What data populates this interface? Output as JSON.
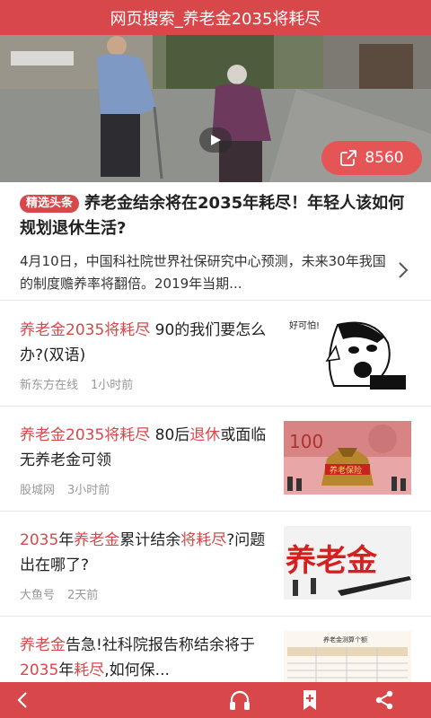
{
  "header": {
    "title": "网页搜索_养老金2035将耗尽"
  },
  "hero": {
    "share_count": "8560"
  },
  "headline": {
    "tag": "精选头条",
    "title": "养老金结余将在2035年耗尽！年轻人该如何规划退休生活?",
    "summary": "4月10日，中国科社院世界社保研究中心预测，未来30年我国的制度赡养率将翻倍。2019年当期..."
  },
  "news": [
    {
      "title_parts": [
        {
          "text": "养老金2035将耗尽",
          "highlight": true
        },
        {
          "text": " 90的我们要怎么办?(双语)",
          "highlight": false
        }
      ],
      "source": "新东方在线",
      "time": "1小时前",
      "thumb_caption": "好可怕!"
    },
    {
      "title_parts": [
        {
          "text": "养老金2035将耗尽",
          "highlight": true
        },
        {
          "text": " 80后",
          "highlight": false
        },
        {
          "text": "退休",
          "highlight": true
        },
        {
          "text": "或面临无养老金可领",
          "highlight": false
        }
      ],
      "source": "股城网",
      "time": "3小时前",
      "thumb_caption": "养老保险"
    },
    {
      "title_parts": [
        {
          "text": "2035",
          "highlight": true
        },
        {
          "text": "年",
          "highlight": false
        },
        {
          "text": "养老金",
          "highlight": true
        },
        {
          "text": "累计结余",
          "highlight": false
        },
        {
          "text": "将耗尽",
          "highlight": true
        },
        {
          "text": "?问题出在哪了?",
          "highlight": false
        }
      ],
      "source": "大鱼号",
      "time": "2天前",
      "thumb_caption": "养老金"
    },
    {
      "title_parts": [
        {
          "text": "养老金",
          "highlight": true
        },
        {
          "text": "告急!社科院报告称结余将于",
          "highlight": false
        },
        {
          "text": "2035",
          "highlight": true
        },
        {
          "text": "年",
          "highlight": false
        },
        {
          "text": "耗尽",
          "highlight": true
        },
        {
          "text": ",如何保...",
          "highlight": false
        }
      ],
      "thumb_caption": "养老金测算个额"
    }
  ],
  "bottom_nav": [
    {
      "icon": "back-arrow-icon"
    },
    {
      "icon": "headphones-icon"
    },
    {
      "icon": "bookmark-add-icon"
    },
    {
      "icon": "share-icon"
    }
  ],
  "colors": {
    "brand": "#d8474a",
    "highlight": "#d8474a",
    "meta": "#999999"
  }
}
